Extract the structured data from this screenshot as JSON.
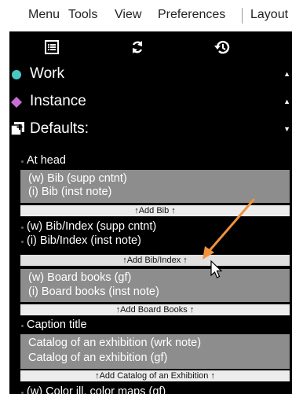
{
  "menubar": {
    "items": [
      "Menu",
      "Tools",
      "View",
      "Preferences",
      "Layout"
    ]
  },
  "toolbar": {
    "icons": [
      "list-icon",
      "sync-icon",
      "history-icon"
    ]
  },
  "colors": {
    "work_dot": "#4ac6c6",
    "instance_diamond": "#c86fd6",
    "group_bg": "#8d8d8d",
    "arrow": "#f0923e"
  },
  "sections": {
    "work": {
      "label": "Work",
      "arrow": "▲"
    },
    "instance": {
      "label": "Instance",
      "arrow": "▲"
    },
    "defaults": {
      "label": "Defaults:",
      "arrow": "▼"
    }
  },
  "defaults": {
    "at_head": "At head",
    "bib_group": [
      "(w) Bib (supp cntnt)",
      "(i) Bib (inst note)"
    ],
    "add_bib": "↑Add Bib ↑",
    "bib_index_items": [
      "(w) Bib/Index (supp cntnt)",
      "(i) Bib/Index (inst note)"
    ],
    "add_bib_index": "↑Add Bib/Index ↑",
    "board_group": [
      "(w) Board books (gf)",
      "(i) Board books (inst note)"
    ],
    "add_board": "↑Add Board Books ↑",
    "caption_title": "Caption title",
    "catalog_group": [
      "Catalog of an exhibition (wrk note)",
      "Catalog of an exhibition (gf)"
    ],
    "add_catalog": "↑Add Catalog of an Exhibition ↑",
    "partial_item": "(w) Color ill. color maps (gf)"
  }
}
